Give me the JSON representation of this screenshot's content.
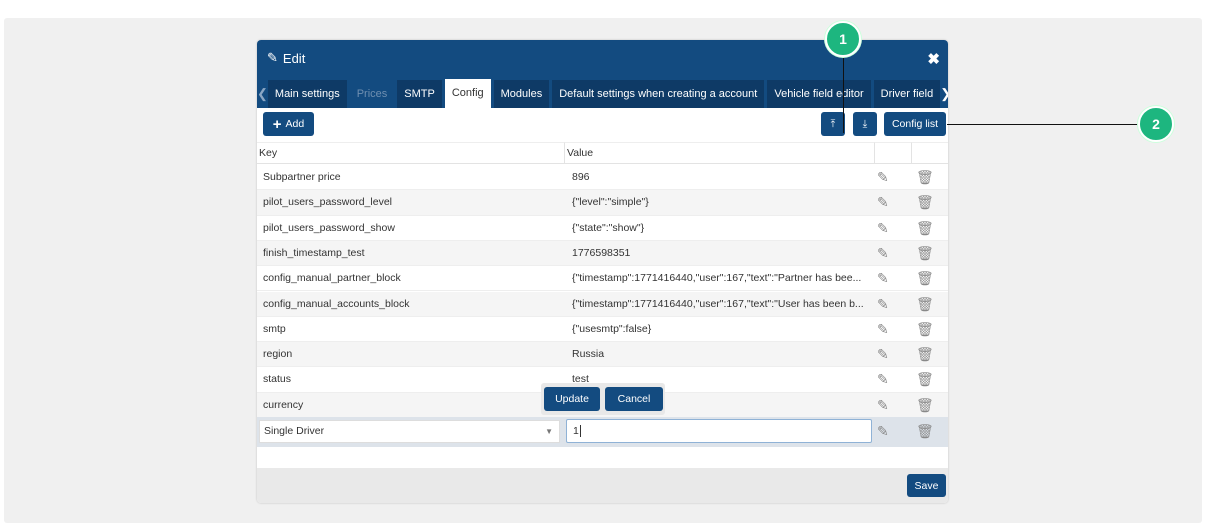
{
  "dialog": {
    "title": "Edit",
    "close_icon": "close-icon"
  },
  "tabs": [
    {
      "label": "Main settings",
      "state": "normal"
    },
    {
      "label": "Prices",
      "state": "disabled"
    },
    {
      "label": "SMTP",
      "state": "normal"
    },
    {
      "label": "Config",
      "state": "active"
    },
    {
      "label": "Modules",
      "state": "normal"
    },
    {
      "label": "Default settings when creating a account",
      "state": "normal"
    },
    {
      "label": "Vehicle field editor",
      "state": "normal"
    },
    {
      "label": "Driver field",
      "state": "normal"
    }
  ],
  "toolbar": {
    "add_label": "Add",
    "config_list_label": "Config list"
  },
  "table": {
    "headers": {
      "key": "Key",
      "value": "Value"
    },
    "rows": [
      {
        "key": "Subpartner price",
        "value": "896"
      },
      {
        "key": "pilot_users_password_level",
        "value": "{\"level\":\"simple\"}"
      },
      {
        "key": "pilot_users_password_show",
        "value": "{\"state\":\"show\"}"
      },
      {
        "key": "finish_timestamp_test",
        "value": "1776598351"
      },
      {
        "key": "config_manual_partner_block",
        "value": "{\"timestamp\":1771416440,\"user\":167,\"text\":\"Partner has bee..."
      },
      {
        "key": "config_manual_accounts_block",
        "value": "{\"timestamp\":1771416440,\"user\":167,\"text\":\"User has been b..."
      },
      {
        "key": "smtp",
        "value": "{\"usesmtp\":false}"
      },
      {
        "key": "region",
        "value": "Russia"
      },
      {
        "key": "status",
        "value": "test"
      },
      {
        "key": "currency",
        "value": ""
      }
    ]
  },
  "edit_row": {
    "key_select": "Single Driver",
    "value_input": "1",
    "update_label": "Update",
    "cancel_label": "Cancel"
  },
  "footer": {
    "save_label": "Save"
  },
  "callouts": [
    "1",
    "2"
  ],
  "colors": {
    "primary": "#134b80",
    "callout": "#1db67f"
  }
}
